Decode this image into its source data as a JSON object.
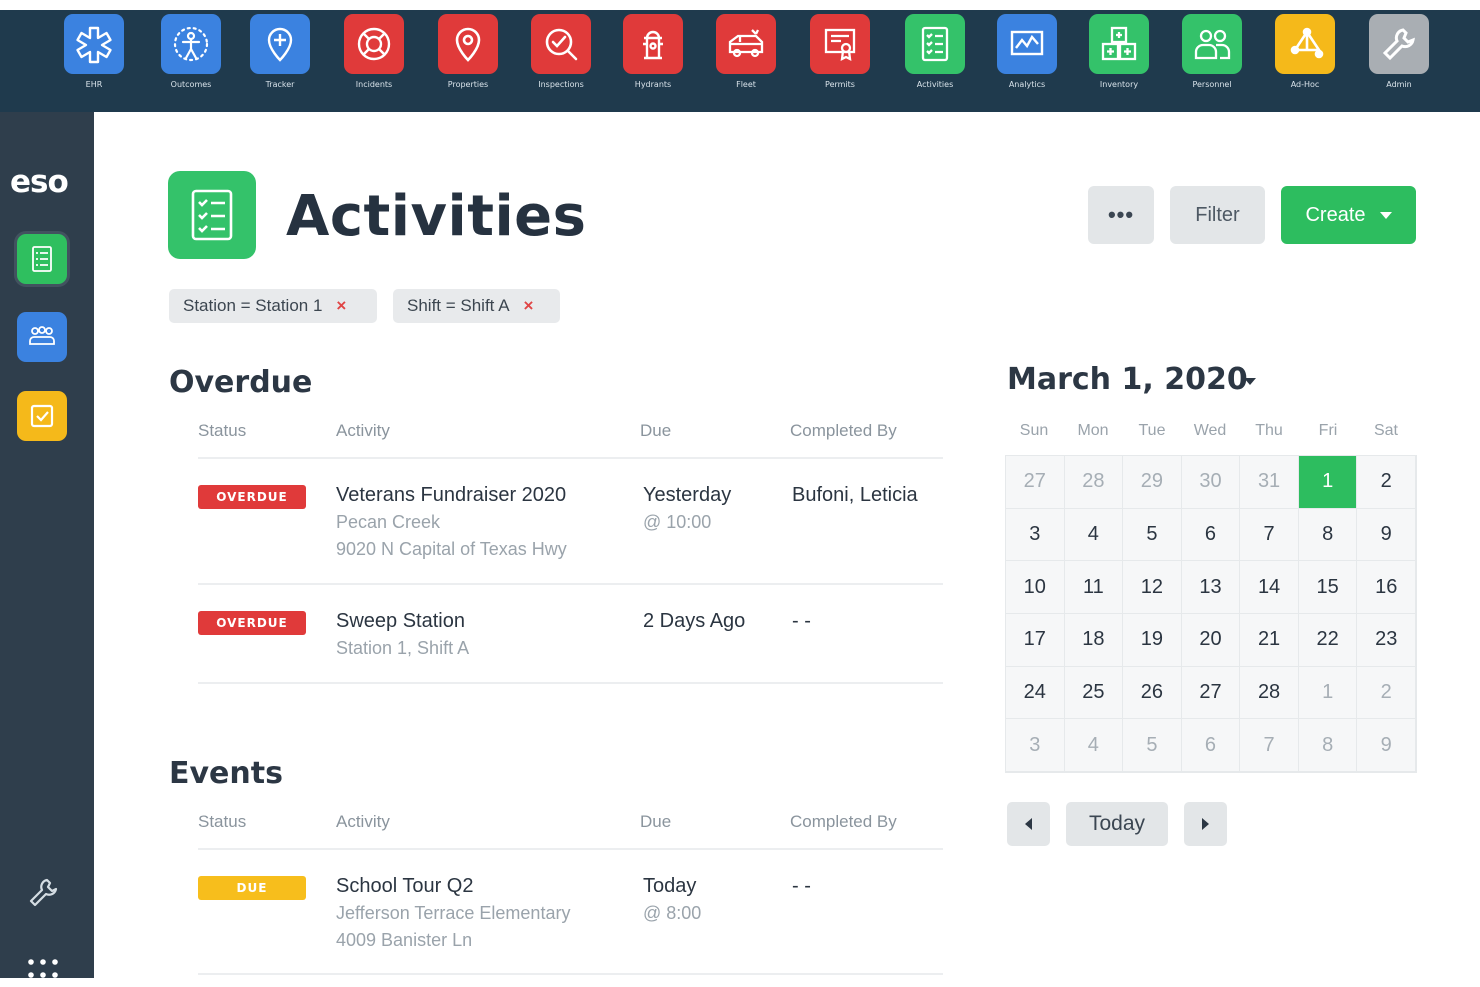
{
  "app_bar": {
    "apps": [
      {
        "label": "EHR",
        "icon": "star-of-life-icon",
        "color": "#3b82e0"
      },
      {
        "label": "Outcomes",
        "icon": "person-radiating-icon",
        "color": "#3b82e0"
      },
      {
        "label": "Tracker",
        "icon": "location-pin-icon",
        "color": "#3b82e0"
      },
      {
        "label": "Incidents",
        "icon": "life-ring-icon",
        "color": "#e03a3a"
      },
      {
        "label": "Properties",
        "icon": "map-pin-icon",
        "color": "#e03a3a"
      },
      {
        "label": "Inspections",
        "icon": "magnifier-check-icon",
        "color": "#e03a3a"
      },
      {
        "label": "Hydrants",
        "icon": "hydrant-icon",
        "color": "#e03a3a"
      },
      {
        "label": "Fleet",
        "icon": "fire-truck-icon",
        "color": "#e03a3a"
      },
      {
        "label": "Permits",
        "icon": "certificate-icon",
        "color": "#e03a3a"
      },
      {
        "label": "Activities",
        "icon": "checklist-icon",
        "color": "#34c26a"
      },
      {
        "label": "Analytics",
        "icon": "line-chart-icon",
        "color": "#3b82e0"
      },
      {
        "label": "Inventory",
        "icon": "inventory-boxes-icon",
        "color": "#34c26a"
      },
      {
        "label": "Personnel",
        "icon": "people-icon",
        "color": "#34c26a"
      },
      {
        "label": "Ad-Hoc",
        "icon": "nodes-icon",
        "color": "#f5b91a"
      },
      {
        "label": "Admin",
        "icon": "wrench-icon",
        "color": "#a9aeb3"
      }
    ]
  },
  "rail": {
    "logo": "eso"
  },
  "header": {
    "title": "Activities",
    "more_label": "•••",
    "filter_label": "Filter",
    "create_label": "Create"
  },
  "filters": [
    {
      "label": "Station = Station 1",
      "remove": "×"
    },
    {
      "label": "Shift = Shift A",
      "remove": "×"
    }
  ],
  "columns": {
    "status": "Status",
    "activity": "Activity",
    "due": "Due",
    "completed_by": "Completed By"
  },
  "overdue": {
    "title": "Overdue",
    "rows": [
      {
        "status": "OVERDUE",
        "activity": "Veterans Fundraiser 2020",
        "sub1": "Pecan Creek",
        "sub2": "9020 N Capital of Texas Hwy",
        "due": "Yesterday",
        "due_sub": "@ 10:00",
        "completed_by": "Bufoni, Leticia"
      },
      {
        "status": "OVERDUE",
        "activity": "Sweep Station",
        "sub1": "Station 1, Shift A",
        "due": "2 Days Ago",
        "completed_by": "- -"
      }
    ]
  },
  "events": {
    "title": "Events",
    "rows": [
      {
        "status": "DUE",
        "activity": "School Tour Q2",
        "sub1": "Jefferson Terrace Elementary",
        "sub2": "4009 Banister Ln",
        "due": "Today",
        "due_sub": "@ 8:00",
        "completed_by": "- -"
      }
    ]
  },
  "calendar": {
    "title": "March 1, 2020",
    "weekdays": [
      "Sun",
      "Mon",
      "Tue",
      "Wed",
      "Thu",
      "Fri",
      "Sat"
    ],
    "days": [
      {
        "d": "27",
        "other": true
      },
      {
        "d": "28",
        "other": true
      },
      {
        "d": "29",
        "other": true
      },
      {
        "d": "30",
        "other": true
      },
      {
        "d": "31",
        "other": true
      },
      {
        "d": "1",
        "selected": true
      },
      {
        "d": "2"
      },
      {
        "d": "3"
      },
      {
        "d": "4"
      },
      {
        "d": "5"
      },
      {
        "d": "6"
      },
      {
        "d": "7"
      },
      {
        "d": "8"
      },
      {
        "d": "9"
      },
      {
        "d": "10"
      },
      {
        "d": "11"
      },
      {
        "d": "12"
      },
      {
        "d": "13"
      },
      {
        "d": "14"
      },
      {
        "d": "15"
      },
      {
        "d": "16"
      },
      {
        "d": "17"
      },
      {
        "d": "18"
      },
      {
        "d": "19"
      },
      {
        "d": "20"
      },
      {
        "d": "21"
      },
      {
        "d": "22"
      },
      {
        "d": "23"
      },
      {
        "d": "24"
      },
      {
        "d": "25"
      },
      {
        "d": "26"
      },
      {
        "d": "27"
      },
      {
        "d": "28"
      },
      {
        "d": "1",
        "other": true
      },
      {
        "d": "2",
        "other": true
      },
      {
        "d": "3",
        "other": true
      },
      {
        "d": "4",
        "other": true
      },
      {
        "d": "5",
        "other": true
      },
      {
        "d": "6",
        "other": true
      },
      {
        "d": "7",
        "other": true
      },
      {
        "d": "8",
        "other": true
      },
      {
        "d": "9",
        "other": true
      }
    ],
    "today_label": "Today"
  },
  "colors": {
    "accent_green": "#2dbd5f",
    "overdue_red": "#e03a3a",
    "due_yellow": "#f7be1c",
    "topbar": "#1f3a4d",
    "rail": "#2f3e4c"
  }
}
